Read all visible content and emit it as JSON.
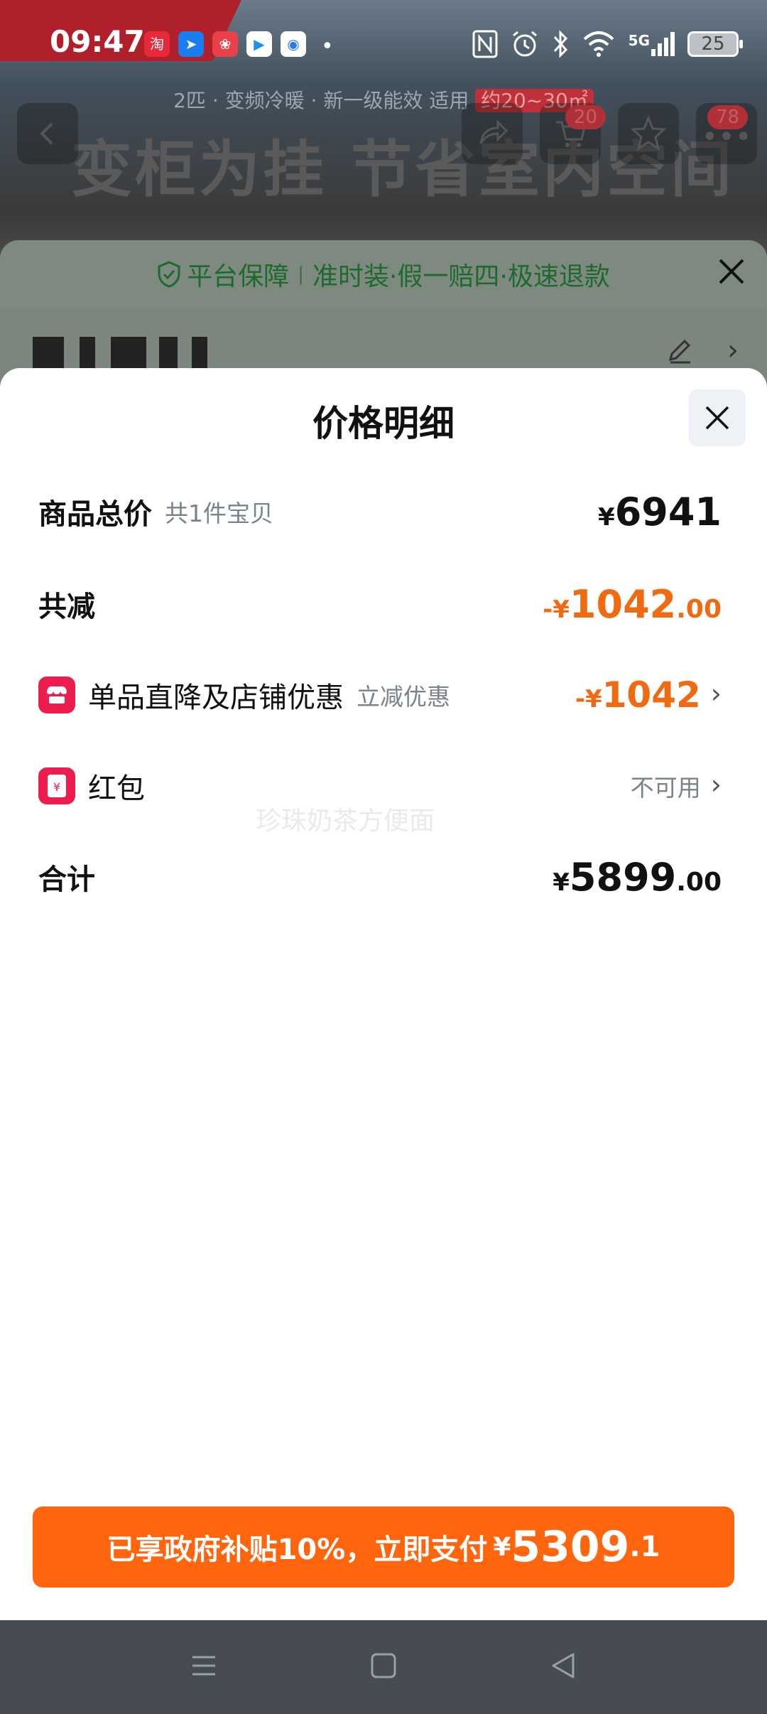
{
  "status_bar": {
    "time": "09:47",
    "network": "5G",
    "battery": "25",
    "app_icons": [
      "taobao-icon",
      "dingtalk-icon",
      "pinduoduo-icon",
      "video-app-icon",
      "browser-icon"
    ]
  },
  "background_page": {
    "subline": "2匹 · 变频冷暖 · 新一级能效 适用",
    "subline_highlight": "约20~30㎡",
    "headline": "变柜为挂 节省室内空间",
    "cart_badge": "20",
    "more_badge": "78"
  },
  "underlying_sheet": {
    "guarantee_label": "平台保障",
    "guarantee_detail": "准时装·假一赔四·极速退款"
  },
  "price_sheet": {
    "title": "价格明细",
    "rows": {
      "total": {
        "label": "商品总价",
        "sub": "共1件宝贝",
        "yen": "¥",
        "int": "6941",
        "dec": ""
      },
      "reduction": {
        "label": "共减",
        "prefix": "-¥",
        "int": "1042",
        "dec": ".00"
      },
      "store_discount": {
        "label": "单品直降及店铺优惠",
        "sub": "立减优惠",
        "prefix": "-¥",
        "int": "1042"
      },
      "red_packet": {
        "label": "红包",
        "value": "不可用"
      },
      "sum": {
        "label": "合计",
        "yen": "¥",
        "int": "5899",
        "dec": ".00"
      }
    },
    "watermark": "珍珠奶茶方便面"
  },
  "pay_button": {
    "text": "已享政府补贴10%，立即支付",
    "yen": "¥",
    "int": "5309",
    "dec": ".1"
  },
  "colors": {
    "accent_orange": "#ff650d",
    "price_orange": "#f06a12",
    "badge_red": "#ee1d4f",
    "nav_bar": "#474b52"
  }
}
